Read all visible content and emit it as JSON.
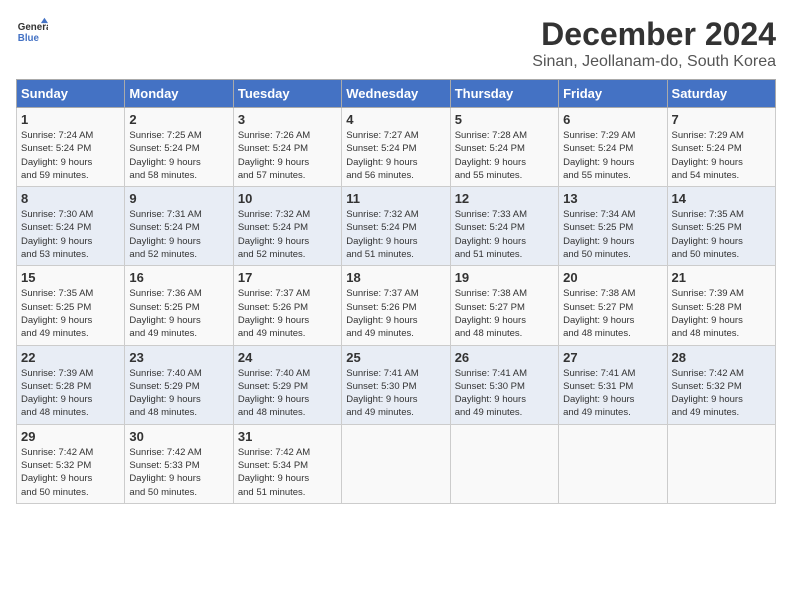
{
  "logo": {
    "line1": "General",
    "line2": "Blue"
  },
  "title": "December 2024",
  "subtitle": "Sinan, Jeollanam-do, South Korea",
  "days_of_week": [
    "Sunday",
    "Monday",
    "Tuesday",
    "Wednesday",
    "Thursday",
    "Friday",
    "Saturday"
  ],
  "weeks": [
    [
      {
        "day": 1,
        "info": "Sunrise: 7:24 AM\nSunset: 5:24 PM\nDaylight: 9 hours\nand 59 minutes."
      },
      {
        "day": 2,
        "info": "Sunrise: 7:25 AM\nSunset: 5:24 PM\nDaylight: 9 hours\nand 58 minutes."
      },
      {
        "day": 3,
        "info": "Sunrise: 7:26 AM\nSunset: 5:24 PM\nDaylight: 9 hours\nand 57 minutes."
      },
      {
        "day": 4,
        "info": "Sunrise: 7:27 AM\nSunset: 5:24 PM\nDaylight: 9 hours\nand 56 minutes."
      },
      {
        "day": 5,
        "info": "Sunrise: 7:28 AM\nSunset: 5:24 PM\nDaylight: 9 hours\nand 55 minutes."
      },
      {
        "day": 6,
        "info": "Sunrise: 7:29 AM\nSunset: 5:24 PM\nDaylight: 9 hours\nand 55 minutes."
      },
      {
        "day": 7,
        "info": "Sunrise: 7:29 AM\nSunset: 5:24 PM\nDaylight: 9 hours\nand 54 minutes."
      }
    ],
    [
      {
        "day": 8,
        "info": "Sunrise: 7:30 AM\nSunset: 5:24 PM\nDaylight: 9 hours\nand 53 minutes."
      },
      {
        "day": 9,
        "info": "Sunrise: 7:31 AM\nSunset: 5:24 PM\nDaylight: 9 hours\nand 52 minutes."
      },
      {
        "day": 10,
        "info": "Sunrise: 7:32 AM\nSunset: 5:24 PM\nDaylight: 9 hours\nand 52 minutes."
      },
      {
        "day": 11,
        "info": "Sunrise: 7:32 AM\nSunset: 5:24 PM\nDaylight: 9 hours\nand 51 minutes."
      },
      {
        "day": 12,
        "info": "Sunrise: 7:33 AM\nSunset: 5:24 PM\nDaylight: 9 hours\nand 51 minutes."
      },
      {
        "day": 13,
        "info": "Sunrise: 7:34 AM\nSunset: 5:25 PM\nDaylight: 9 hours\nand 50 minutes."
      },
      {
        "day": 14,
        "info": "Sunrise: 7:35 AM\nSunset: 5:25 PM\nDaylight: 9 hours\nand 50 minutes."
      }
    ],
    [
      {
        "day": 15,
        "info": "Sunrise: 7:35 AM\nSunset: 5:25 PM\nDaylight: 9 hours\nand 49 minutes."
      },
      {
        "day": 16,
        "info": "Sunrise: 7:36 AM\nSunset: 5:25 PM\nDaylight: 9 hours\nand 49 minutes."
      },
      {
        "day": 17,
        "info": "Sunrise: 7:37 AM\nSunset: 5:26 PM\nDaylight: 9 hours\nand 49 minutes."
      },
      {
        "day": 18,
        "info": "Sunrise: 7:37 AM\nSunset: 5:26 PM\nDaylight: 9 hours\nand 49 minutes."
      },
      {
        "day": 19,
        "info": "Sunrise: 7:38 AM\nSunset: 5:27 PM\nDaylight: 9 hours\nand 48 minutes."
      },
      {
        "day": 20,
        "info": "Sunrise: 7:38 AM\nSunset: 5:27 PM\nDaylight: 9 hours\nand 48 minutes."
      },
      {
        "day": 21,
        "info": "Sunrise: 7:39 AM\nSunset: 5:28 PM\nDaylight: 9 hours\nand 48 minutes."
      }
    ],
    [
      {
        "day": 22,
        "info": "Sunrise: 7:39 AM\nSunset: 5:28 PM\nDaylight: 9 hours\nand 48 minutes."
      },
      {
        "day": 23,
        "info": "Sunrise: 7:40 AM\nSunset: 5:29 PM\nDaylight: 9 hours\nand 48 minutes."
      },
      {
        "day": 24,
        "info": "Sunrise: 7:40 AM\nSunset: 5:29 PM\nDaylight: 9 hours\nand 48 minutes."
      },
      {
        "day": 25,
        "info": "Sunrise: 7:41 AM\nSunset: 5:30 PM\nDaylight: 9 hours\nand 49 minutes."
      },
      {
        "day": 26,
        "info": "Sunrise: 7:41 AM\nSunset: 5:30 PM\nDaylight: 9 hours\nand 49 minutes."
      },
      {
        "day": 27,
        "info": "Sunrise: 7:41 AM\nSunset: 5:31 PM\nDaylight: 9 hours\nand 49 minutes."
      },
      {
        "day": 28,
        "info": "Sunrise: 7:42 AM\nSunset: 5:32 PM\nDaylight: 9 hours\nand 49 minutes."
      }
    ],
    [
      {
        "day": 29,
        "info": "Sunrise: 7:42 AM\nSunset: 5:32 PM\nDaylight: 9 hours\nand 50 minutes."
      },
      {
        "day": 30,
        "info": "Sunrise: 7:42 AM\nSunset: 5:33 PM\nDaylight: 9 hours\nand 50 minutes."
      },
      {
        "day": 31,
        "info": "Sunrise: 7:42 AM\nSunset: 5:34 PM\nDaylight: 9 hours\nand 51 minutes."
      },
      null,
      null,
      null,
      null
    ]
  ]
}
